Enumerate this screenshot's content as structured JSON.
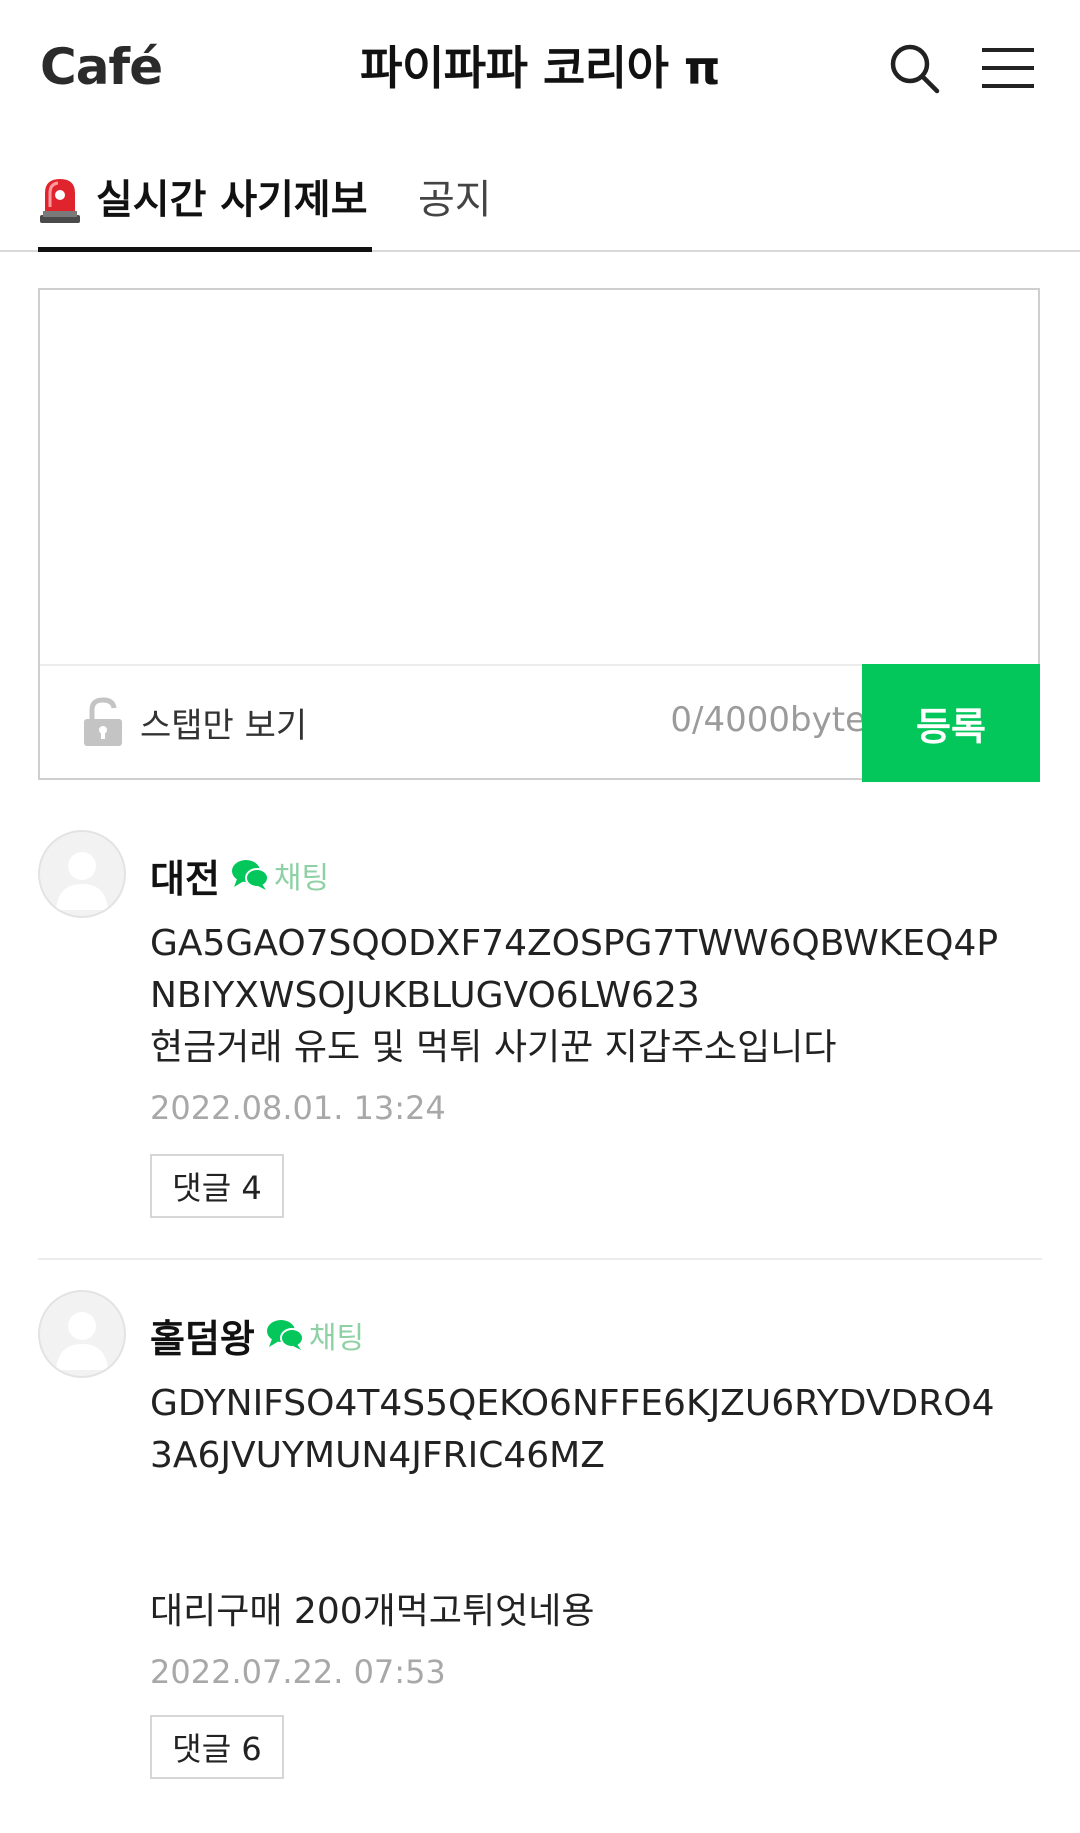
{
  "header": {
    "logo": "Café",
    "title": "파이파파 코리아 π"
  },
  "tabs": [
    {
      "label": "실시간 사기제보",
      "active": true
    },
    {
      "label": "공지",
      "active": false
    }
  ],
  "compose": {
    "value": "",
    "staff_only_label": "스탭만 보기",
    "byte_counter": "0/4000byte",
    "submit_label": "등록"
  },
  "comments": [
    {
      "author": "대전",
      "chat_label": "채팅",
      "body": "GA5GAO7SQODXF74ZOSPG7TWW6QBWKEQ4P\nNBIYXWSOJUKBLUGVO6LW623\n현금거래 유도 및 먹튀 사기꾼 지갑주소입니다",
      "date": "2022.08.01. 13:24",
      "reply_label": "댓글 4"
    },
    {
      "author": "홀덤왕",
      "chat_label": "채팅",
      "body": "GDYNIFSO4T4S5QEKO6NFFE6KJZU6RYDVDRO4\n3A6JVUYMUN4JFRIC46MZ\n\n\n대리구매 200개먹고튀엇네용",
      "date": "2022.07.22. 07:53",
      "reply_label": "댓글 6"
    }
  ],
  "colors": {
    "accent": "#03c75a",
    "chat": "#8fd1a5",
    "muted": "#a8a8a8"
  }
}
